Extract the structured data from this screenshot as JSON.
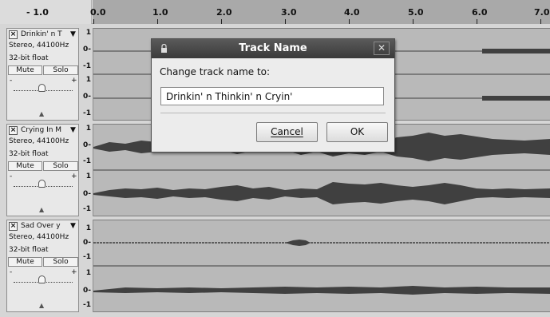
{
  "ruler": {
    "left_label": "- 1.0",
    "ticks": [
      "0.0",
      "1.0",
      "2.0",
      "3.0",
      "4.0",
      "5.0",
      "6.0",
      "7.0"
    ]
  },
  "tracks": [
    {
      "name": "Drinkin' n T",
      "format": "Stereo, 44100Hz",
      "bits": "32-bit float",
      "mute": "Mute",
      "solo": "Solo",
      "scale_top": [
        "1",
        "0-",
        "-1"
      ],
      "scale_bottom": [
        "1",
        "0-",
        "-1"
      ]
    },
    {
      "name": "Crying In M",
      "format": "Stereo, 44100Hz",
      "bits": "32-bit float",
      "mute": "Mute",
      "solo": "Solo",
      "scale_top": [
        "1",
        "0-",
        "-1"
      ],
      "scale_bottom": [
        "1",
        "0-",
        "-1"
      ]
    },
    {
      "name": "Sad Over y",
      "format": "Stereo, 44100Hz",
      "bits": "32-bit float",
      "mute": "Mute",
      "solo": "Solo",
      "scale_top": [
        "1",
        "0-",
        "-1"
      ],
      "scale_bottom": [
        "1",
        "0-",
        "-1"
      ]
    }
  ],
  "gain_slider": {
    "minus": "-",
    "plus": "+"
  },
  "dialog": {
    "title": "Track Name",
    "close": "✕",
    "prompt": "Change track name to:",
    "value": "Drinkin' n Thinkin' n Cryin'",
    "cancel_label": "Cancel",
    "ok_label": "OK"
  },
  "colors": {
    "wave_bg": "#b9b9b9",
    "waveform": "#404040",
    "dialog_title_bg": "#3f3f3f"
  }
}
